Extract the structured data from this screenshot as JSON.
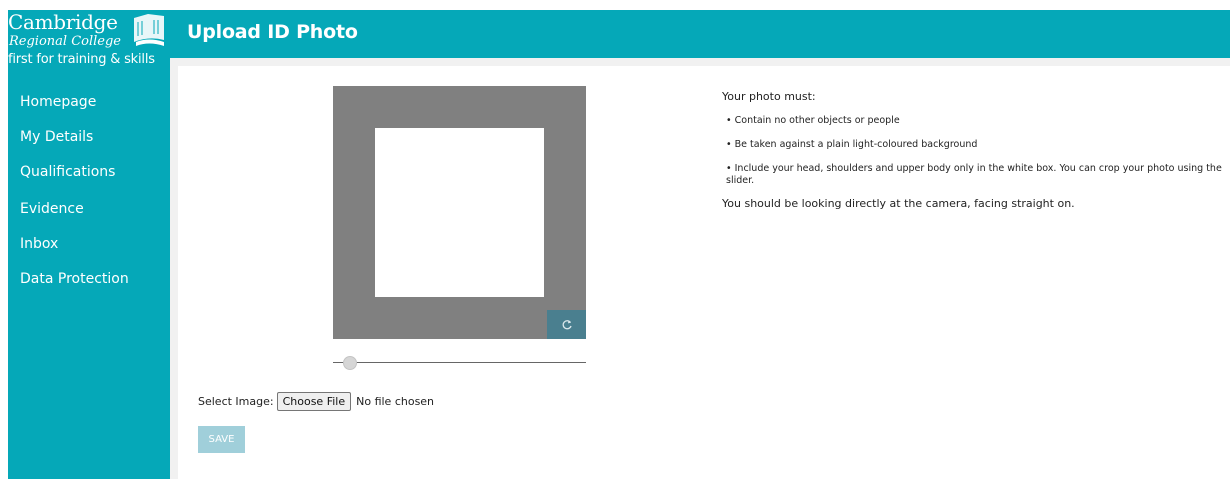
{
  "branding": {
    "line1": "Cambridge",
    "line2": "Regional College",
    "line3": "first for training & skills"
  },
  "header": {
    "title": "Upload ID Photo"
  },
  "sidebar": {
    "items": [
      {
        "label": "Homepage"
      },
      {
        "label": "My Details"
      },
      {
        "label": "Qualifications"
      },
      {
        "label": "Evidence"
      },
      {
        "label": "Inbox"
      },
      {
        "label": "Data Protection"
      }
    ]
  },
  "cropper": {
    "rotate_icon": "rotate-icon",
    "zoom_level": 0.04
  },
  "file_select": {
    "label": "Select Image:",
    "button": "Choose File",
    "status": "No file chosen"
  },
  "save_button": {
    "label": "SAVE"
  },
  "instructions": {
    "heading": "Your photo must:",
    "bullets": [
      "• Contain no other objects or people",
      "• Be taken against a plain light-coloured background",
      "• Include your head, shoulders and upper body only in the white box. You can crop your photo using the slider."
    ],
    "note": "You should be looking directly at the camera, facing straight on."
  },
  "colors": {
    "brand": "#05a8b8",
    "crop_background": "#808080",
    "rotate_button": "#4a7f8f",
    "save_disabled": "#a0cfda"
  }
}
